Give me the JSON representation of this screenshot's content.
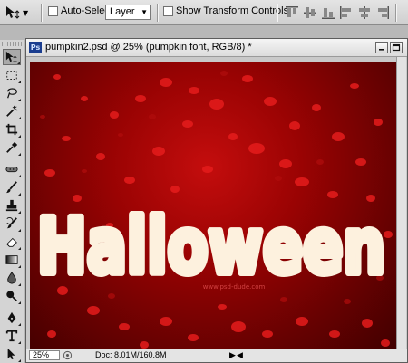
{
  "options_bar": {
    "auto_select_label": "Auto-Select:",
    "auto_select_value": "Layer",
    "transform_controls_label": "Show Transform Controls"
  },
  "document": {
    "title": "pumpkin2.psd @ 25% (pumpkin font, RGB/8) *",
    "badge": "Ps",
    "canvas_text": "Halloween",
    "watermark": "www.psd-dude.com",
    "colors": {
      "background": "#9a0303",
      "lettering": "#fdf1de",
      "pumpkins": "#e51c1c"
    }
  },
  "status_bar": {
    "zoom": "25%",
    "doc_info": "Doc: 8.01M/160.8M"
  },
  "icons": {
    "options_tool": "move-tool-icon",
    "tools": [
      "move-tool-icon",
      "marquee-tool-icon",
      "lasso-tool-icon",
      "magic-wand-icon",
      "crop-tool-icon",
      "eyedropper-icon",
      "healing-brush-icon",
      "brush-tool-icon",
      "clone-stamp-icon",
      "history-brush-icon",
      "eraser-icon",
      "gradient-icon",
      "blur-icon",
      "dodge-icon",
      "pen-tool-icon",
      "type-tool-icon",
      "path-selection-icon"
    ]
  }
}
